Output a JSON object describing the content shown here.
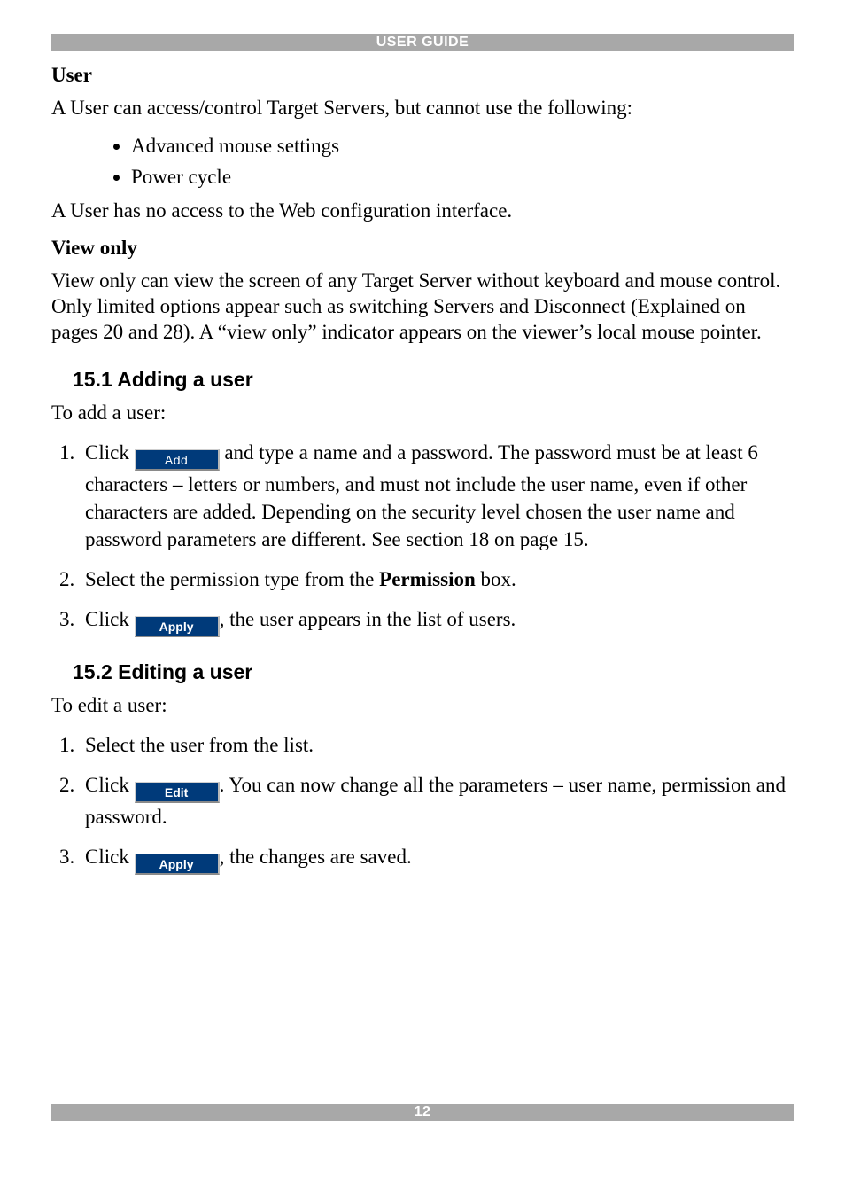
{
  "header": {
    "title": "USER GUIDE"
  },
  "footer": {
    "page_number": "12"
  },
  "sections": {
    "user": {
      "heading": "User",
      "intro": "A User can access/control Target Servers, but cannot use the following:",
      "bullets": [
        "Advanced mouse settings",
        "Power cycle"
      ],
      "closing": "A User has no access to the Web configuration interface."
    },
    "view_only": {
      "heading": "View only",
      "para": "View only can view the screen of any Target Server without keyboard and mouse control. Only limited options appear such as switching Servers and Disconnect (Explained on pages 20 and 28). A “view only” indicator appears on the viewer’s local mouse pointer."
    },
    "adding": {
      "heading": "15.1 Adding a user",
      "intro": "To add a user:",
      "steps": {
        "s1_pre": "Click ",
        "s1_button": "Add",
        "s1_post": " and type a name and a password. The password must be at least 6 characters – letters or numbers, and must not include the user name, even if other characters are added. Depending on the security level chosen the user name and password parameters are different. See section 18 on page 15.",
        "s2_pre": "Select the permission type from the ",
        "s2_bold": "Permission",
        "s2_post": " box.",
        "s3_pre": "Click ",
        "s3_button": "Apply",
        "s3_post": ", the user appears in the list of users."
      }
    },
    "editing": {
      "heading": "15.2 Editing a user",
      "intro": "To edit a user:",
      "steps": {
        "s1": "Select the user from the list.",
        "s2_pre": "Click ",
        "s2_button": "Edit",
        "s2_post": ". You can now change all the parameters – user name, permission and password.",
        "s3_pre": "Click ",
        "s3_button": "Apply",
        "s3_post": ", the changes are saved."
      }
    }
  }
}
